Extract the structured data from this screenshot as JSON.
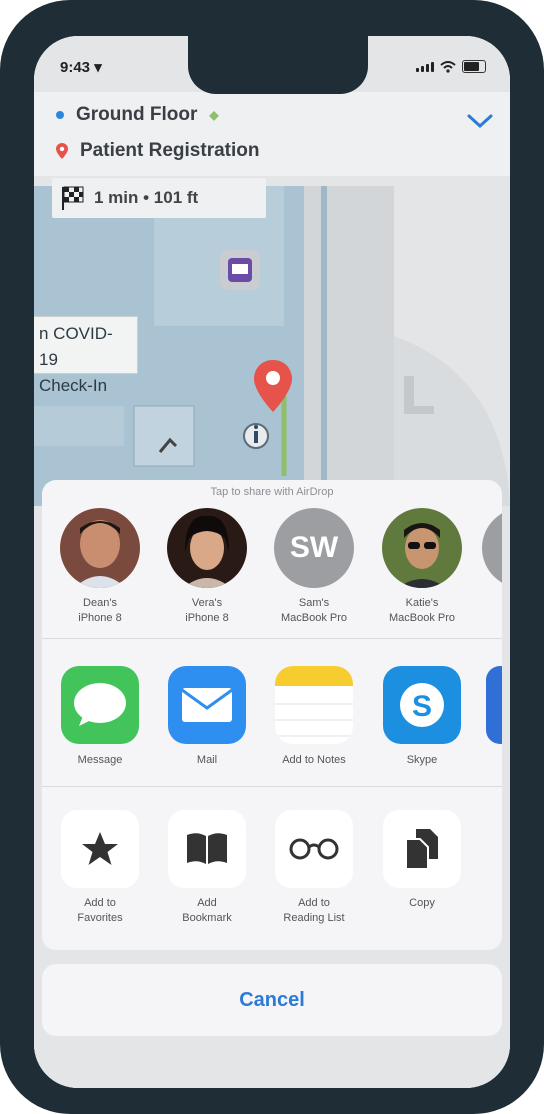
{
  "status_bar": {
    "time": "9:43 ▾"
  },
  "route": {
    "origin": "Ground Floor",
    "destination": "Patient Registration",
    "eta": "1 min  •  101 ft"
  },
  "map": {
    "poi_label": "COVID-19\nCheck-In",
    "poi_line1": "n COVID-19",
    "poi_line2": "Check-In"
  },
  "share_sheet": {
    "airdrop_hint": "Tap to share with AirDrop",
    "contacts": [
      {
        "name_line1": "Dean's",
        "name_line2": "iPhone 8"
      },
      {
        "name_line1": "Vera's",
        "name_line2": "iPhone 8"
      },
      {
        "name_line1": "Sam's",
        "name_line2": "MacBook Pro",
        "initials": "SW"
      },
      {
        "name_line1": "Katie's",
        "name_line2": "MacBook Pro"
      }
    ],
    "apps": [
      {
        "label": "Message"
      },
      {
        "label": "Mail"
      },
      {
        "label": "Add to Notes"
      },
      {
        "label": "Skype"
      }
    ],
    "actions": [
      {
        "line1": "Add to",
        "line2": "Favorites"
      },
      {
        "line1": "Add",
        "line2": "Bookmark"
      },
      {
        "line1": "Add to",
        "line2": "Reading List"
      },
      {
        "line1": "Copy",
        "line2": ""
      }
    ]
  },
  "cancel_label": "Cancel",
  "colors": {
    "accent": "#2c7ad8",
    "pin": "#e5534b",
    "frame": "#1f2e36"
  }
}
